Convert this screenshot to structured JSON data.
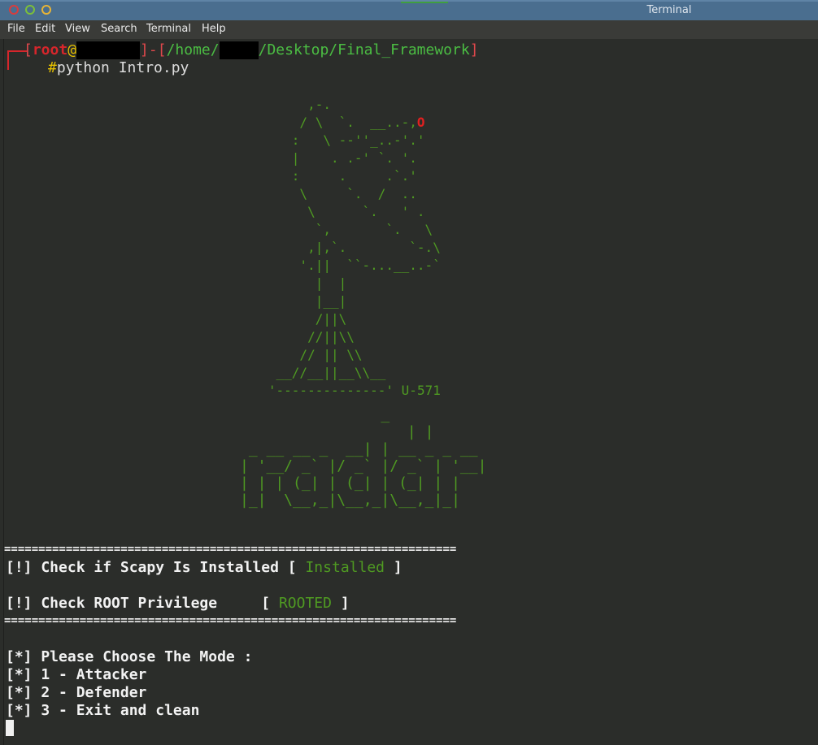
{
  "window": {
    "title": "Terminal"
  },
  "menu": [
    "File",
    "Edit",
    "View",
    "Search",
    "Terminal",
    "Help"
  ],
  "prompt": {
    "user": "root",
    "at": "@",
    "dash": "-",
    "path_part1": "/home/",
    "path_part2": "/Desktop/Final_Framework",
    "hash": "#",
    "command": "python Intro.py"
  },
  "art": {
    "dish_lines": [
      "        ,-.",
      "       / \\  `.  __..-,",
      "      :   \\ --''_..-'.'",
      "      |    . .-' `. '.",
      "      :     .     .`.'",
      "       \\     `.  /  ..",
      "        \\      `.   ' .",
      "         `,       `.   \\",
      "        ,|,`.        `-.\\",
      "       '.||  ``-...__..-`",
      "         |  |",
      "         |__|",
      "         /||\\",
      "        //||\\\\",
      "       // || \\\\",
      "    __//__||__\\\\__",
      "   '--------------'"
    ],
    "dish_marker": "O",
    "tag": "U-571",
    "logo_lines": [
      "                _",
      "                   | |",
      " _ __ __ _  __| | __ _ _ __",
      "| '__/ _` |/ _` |/ _` | '__|",
      "| | | (_| | (_| | (_| | |",
      "|_|  \\__,_|\\__,_|\\__,_|_|"
    ]
  },
  "checks": {
    "separator": "==================================================================",
    "scapy_label": "[!] Check if Scapy Is Installed [ ",
    "scapy_status": "Installed",
    "root_label": "[!] Check ROOT Privilege     [ ",
    "root_status": "ROOTED",
    "close_bracket": " ]"
  },
  "mode_menu": [
    "[*] Please Choose The Mode :",
    "[*] 1 - Attacker",
    "[*] 2 - Defender",
    "[*] 3 - Exit and clean"
  ],
  "colors": {
    "titlebar": "#4a6e8f",
    "background": "#2b2d2a",
    "art_green": "#4f9a22",
    "prompt_red": "#d6262b"
  }
}
